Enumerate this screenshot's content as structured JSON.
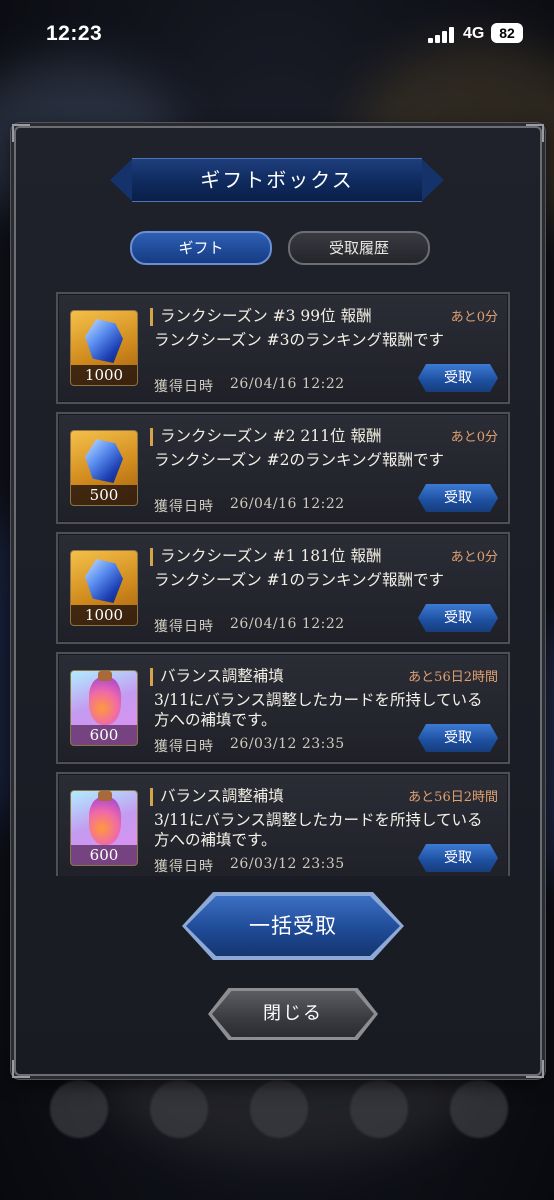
{
  "status_bar": {
    "time": "12:23",
    "network": "4G",
    "battery": "82"
  },
  "modal": {
    "title": "ギフトボックス",
    "tabs": [
      {
        "label": "ギフト",
        "active": true
      },
      {
        "label": "受取履歴",
        "active": false
      }
    ],
    "gifts": [
      {
        "title": "ランクシーズン #3 99位 報酬",
        "remaining": "あと0分",
        "description": "ランクシーズン #3のランキング報酬です",
        "quantity": "1000",
        "item_icon": "crystal-icon",
        "date_label": "獲得日時",
        "date": "26/04/16 12:22",
        "button": "受取"
      },
      {
        "title": "ランクシーズン #2 211位 報酬",
        "remaining": "あと0分",
        "description": "ランクシーズン #2のランキング報酬です",
        "quantity": "500",
        "item_icon": "crystal-icon",
        "date_label": "獲得日時",
        "date": "26/04/16 12:22",
        "button": "受取"
      },
      {
        "title": "ランクシーズン #1 181位 報酬",
        "remaining": "あと0分",
        "description": "ランクシーズン #1のランキング報酬です",
        "quantity": "1000",
        "item_icon": "crystal-icon",
        "date_label": "獲得日時",
        "date": "26/04/16 12:22",
        "button": "受取"
      },
      {
        "title": "バランス調整補填",
        "remaining": "あと56日2時間",
        "description": "3/11にバランス調整したカードを所持している方への補填です。",
        "quantity": "600",
        "item_icon": "potion-icon",
        "date_label": "獲得日時",
        "date": "26/03/12 23:35",
        "button": "受取"
      },
      {
        "title": "バランス調整補填",
        "remaining": "あと56日2時間",
        "description": "3/11にバランス調整したカードを所持している方への補填です。",
        "quantity": "600",
        "item_icon": "potion-icon",
        "date_label": "獲得日時",
        "date": "26/03/12 23:35",
        "button": "受取"
      }
    ],
    "receive_all_label": "一括受取",
    "close_label": "閉じる"
  },
  "colors": {
    "accent_blue": "#1e4f9f",
    "remaining_text": "#e0a070",
    "title_bar_gold": "#d6a24a"
  }
}
